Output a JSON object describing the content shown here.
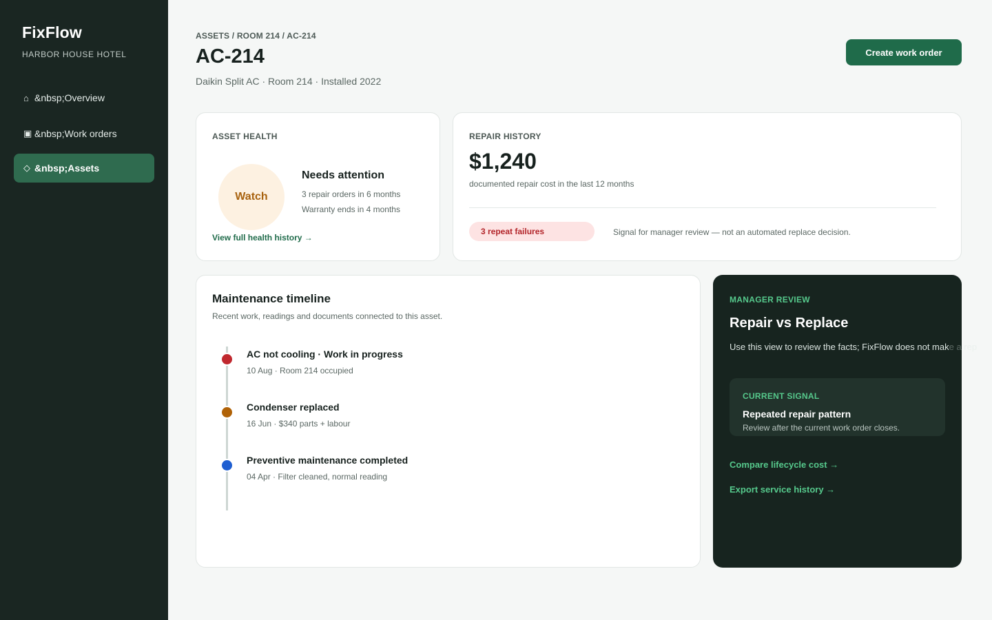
{
  "sidebar": {
    "brand": "FixFlow",
    "org": "HARBOR HOUSE HOTEL",
    "items": [
      {
        "icon": "⌂",
        "label": "&nbsp;Overview",
        "active": false
      },
      {
        "icon": "▣",
        "label": "&nbsp;Work orders",
        "active": false
      },
      {
        "icon": "◇",
        "label": "&nbsp;Assets",
        "active": true
      }
    ]
  },
  "header": {
    "breadcrumb": "ASSETS / ROOM 214 / AC-214",
    "title": "AC-214",
    "subtitle": "Daikin Split AC · Room 214 · Installed 2022",
    "primary_action": "Create work order"
  },
  "asset_health": {
    "label": "ASSET HEALTH",
    "badge": "Watch",
    "status": "Needs attention",
    "lines": [
      "3 repair orders in 6 months",
      "Warranty ends in 4 months"
    ],
    "link": "View full health history →"
  },
  "repair_history": {
    "label": "REPAIR HISTORY",
    "amount": "$1,240",
    "description": "documented repair cost in the last 12 months",
    "badge": "3 repeat failures",
    "note": "Signal for manager review — not an automated replace decision."
  },
  "timeline": {
    "title": "Maintenance timeline",
    "subtitle": "Recent work, readings and documents connected to this asset.",
    "items": [
      {
        "title": "AC not cooling · Work in progress",
        "meta": "10 Aug · Room 214 occupied",
        "color": "#c0282e"
      },
      {
        "title": "Condenser replaced",
        "meta": "16 Jun · $340 parts + labour",
        "color": "#b06207"
      },
      {
        "title": "Preventive maintenance completed",
        "meta": "04 Apr · Filter cleaned, normal reading",
        "color": "#1f5fd1"
      }
    ]
  },
  "manager_review": {
    "label": "MANAGER REVIEW",
    "title": "Repair vs Replace",
    "description": "Use this view to review the facts; FixFlow does not mak",
    "description_overflow": "e a rep",
    "signal": {
      "label": "CURRENT SIGNAL",
      "title": "Repeated repair pattern",
      "description": "Review after the current work order closes."
    },
    "links": [
      "Compare lifecycle cost →",
      "Export service history →"
    ]
  }
}
